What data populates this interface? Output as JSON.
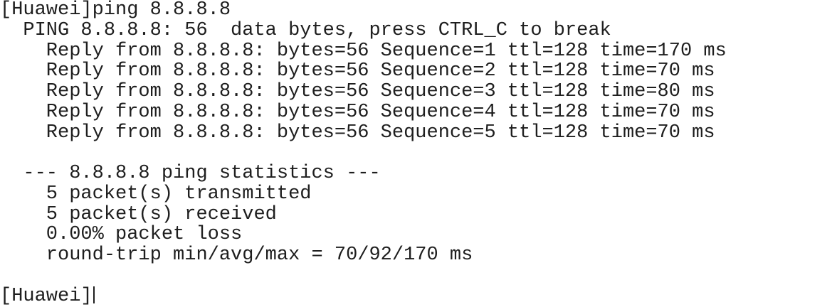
{
  "terminal": {
    "lines": [
      "[Huawei]ping 8.8.8.8",
      "  PING 8.8.8.8: 56  data bytes, press CTRL_C to break",
      "    Reply from 8.8.8.8: bytes=56 Sequence=1 ttl=128 time=170 ms",
      "    Reply from 8.8.8.8: bytes=56 Sequence=2 ttl=128 time=70 ms",
      "    Reply from 8.8.8.8: bytes=56 Sequence=3 ttl=128 time=80 ms",
      "    Reply from 8.8.8.8: bytes=56 Sequence=4 ttl=128 time=70 ms",
      "    Reply from 8.8.8.8: bytes=56 Sequence=5 ttl=128 time=70 ms",
      "",
      "  --- 8.8.8.8 ping statistics ---",
      "    5 packet(s) transmitted",
      "    5 packet(s) received",
      "    0.00% packet loss",
      "    round-trip min/avg/max = 70/92/170 ms",
      ""
    ],
    "prompt": "[Huawei]"
  }
}
